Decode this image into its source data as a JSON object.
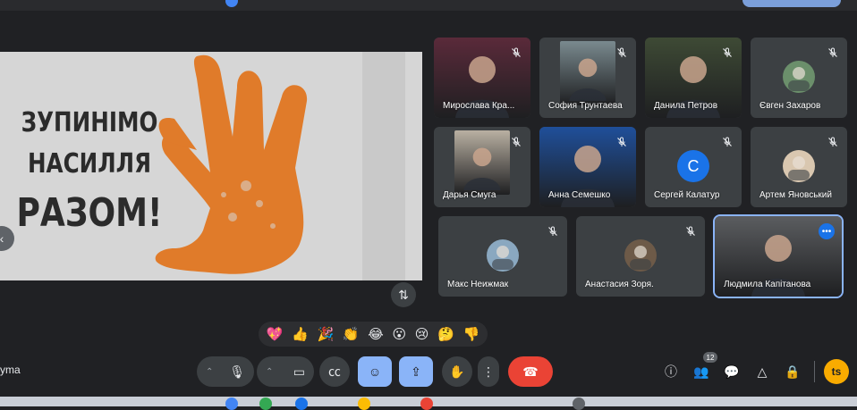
{
  "slide": {
    "line1": "ЗУПИНІМО",
    "line2": "НАСИЛЛЯ",
    "line3": "РАЗОМ!",
    "hand_color": "#e07b2a"
  },
  "participants": [
    {
      "name": "Мирослава Кра...",
      "type": "video",
      "bg": "#5a2a3a"
    },
    {
      "name": "София Трунтаева",
      "type": "video",
      "bg": "#7a8a8f"
    },
    {
      "name": "Данила Петров",
      "type": "video",
      "bg": "#3e4a35"
    },
    {
      "name": "Євген Захаров",
      "type": "avatar-img",
      "bg": "#6b8f6b"
    },
    {
      "name": "Дарья Смуга",
      "type": "video",
      "bg": "#b9b0a2"
    },
    {
      "name": "Анна Семешко",
      "type": "video",
      "bg": "#1f4f9a"
    },
    {
      "name": "Сергей Калатур",
      "type": "letter",
      "letter": "С"
    },
    {
      "name": "Артем Яновський",
      "type": "avatar-img",
      "bg": "#d9c7b0"
    },
    {
      "name": "Макс Неижмак",
      "type": "avatar-img",
      "bg": "#8aa8c0"
    },
    {
      "name": "Анастасия Зоря.",
      "type": "avatar-img",
      "bg": "#6d5a48"
    },
    {
      "name": "Людмила Капітанова",
      "type": "video",
      "bg": "#5b5d60"
    }
  ],
  "reactions": [
    "💖",
    "👍",
    "🎉",
    "👏",
    "😂",
    "😮",
    "😢",
    "🤔",
    "👎"
  ],
  "meeting": {
    "name_fragment": "yma"
  },
  "controls": {
    "people_count": "12",
    "self_initial": "ts"
  },
  "colors": {
    "accent": "#8ab4f8",
    "end_call": "#ea4335",
    "bg": "#202124"
  }
}
